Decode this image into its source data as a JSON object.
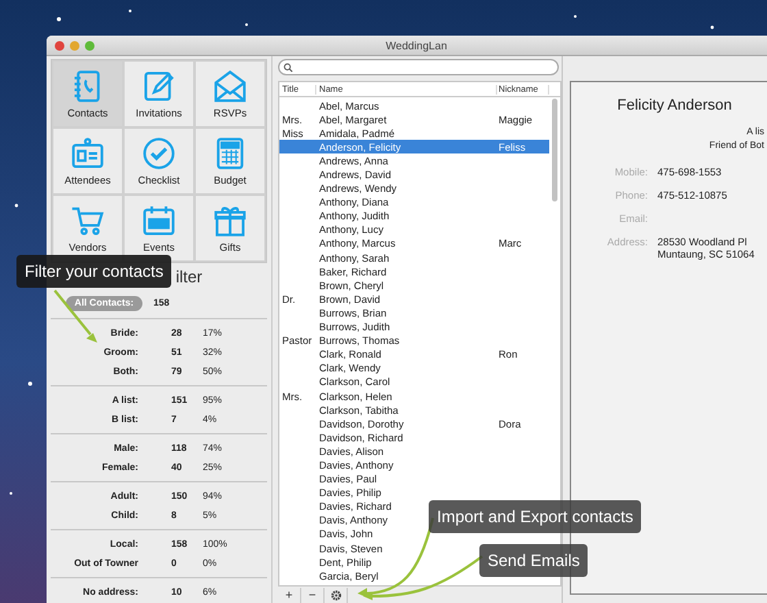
{
  "window": {
    "title": "WeddingLan"
  },
  "sections": [
    {
      "label": "Contacts",
      "selected": true
    },
    {
      "label": "Invitations",
      "selected": false
    },
    {
      "label": "RSVPs",
      "selected": false
    },
    {
      "label": "Attendees",
      "selected": false
    },
    {
      "label": "Checklist",
      "selected": false
    },
    {
      "label": "Budget",
      "selected": false
    },
    {
      "label": "Vendors",
      "selected": false
    },
    {
      "label": "Events",
      "selected": false
    },
    {
      "label": "Gifts",
      "selected": false
    }
  ],
  "filter": {
    "heading": "ilter",
    "all": {
      "label": "All Contacts:",
      "count": "158"
    },
    "groups": [
      [
        {
          "label": "Bride:",
          "count": "28",
          "percent": "17%"
        },
        {
          "label": "Groom:",
          "count": "51",
          "percent": "32%"
        },
        {
          "label": "Both:",
          "count": "79",
          "percent": "50%"
        }
      ],
      [
        {
          "label": "A list:",
          "count": "151",
          "percent": "95%"
        },
        {
          "label": "B list:",
          "count": "7",
          "percent": "4%"
        }
      ],
      [
        {
          "label": "Male:",
          "count": "118",
          "percent": "74%"
        },
        {
          "label": "Female:",
          "count": "40",
          "percent": "25%"
        }
      ],
      [
        {
          "label": "Adult:",
          "count": "150",
          "percent": "94%"
        },
        {
          "label": "Child:",
          "count": "8",
          "percent": "5%"
        }
      ],
      [
        {
          "label": "Local:",
          "count": "158",
          "percent": "100%"
        },
        {
          "label": "Out of Towner",
          "count": "0",
          "percent": "0%"
        }
      ],
      [
        {
          "label": "No address:",
          "count": "10",
          "percent": "6%"
        }
      ]
    ]
  },
  "table": {
    "columns": [
      "Title",
      "Name",
      "Nickname"
    ],
    "rows": [
      {
        "title": "",
        "name": "Abel, Marcus",
        "nickname": "",
        "selected": false
      },
      {
        "title": "Mrs.",
        "name": "Abel, Margaret",
        "nickname": "Maggie",
        "selected": false
      },
      {
        "title": "Miss",
        "name": "Amidala, Padmé",
        "nickname": "",
        "selected": false
      },
      {
        "title": "",
        "name": "Anderson, Felicity",
        "nickname": "Feliss",
        "selected": true
      },
      {
        "title": "",
        "name": "Andrews, Anna",
        "nickname": "",
        "selected": false
      },
      {
        "title": "",
        "name": "Andrews, David",
        "nickname": "",
        "selected": false
      },
      {
        "title": "",
        "name": "Andrews, Wendy",
        "nickname": "",
        "selected": false
      },
      {
        "title": "",
        "name": "Anthony, Diana",
        "nickname": "",
        "selected": false
      },
      {
        "title": "",
        "name": "Anthony, Judith",
        "nickname": "",
        "selected": false
      },
      {
        "title": "",
        "name": "Anthony, Lucy",
        "nickname": "",
        "selected": false
      },
      {
        "title": "",
        "name": "Anthony, Marcus",
        "nickname": "Marc",
        "selected": false
      },
      {
        "title": "",
        "name": "Anthony, Sarah",
        "nickname": "",
        "selected": false
      },
      {
        "title": "",
        "name": "Baker, Richard",
        "nickname": "",
        "selected": false
      },
      {
        "title": "",
        "name": "Brown, Cheryl",
        "nickname": "",
        "selected": false
      },
      {
        "title": "Dr.",
        "name": "Brown, David",
        "nickname": "",
        "selected": false
      },
      {
        "title": "",
        "name": "Burrows, Brian",
        "nickname": "",
        "selected": false
      },
      {
        "title": "",
        "name": "Burrows, Judith",
        "nickname": "",
        "selected": false
      },
      {
        "title": "Pastor",
        "name": "Burrows, Thomas",
        "nickname": "",
        "selected": false
      },
      {
        "title": "",
        "name": "Clark, Ronald",
        "nickname": "Ron",
        "selected": false
      },
      {
        "title": "",
        "name": "Clark, Wendy",
        "nickname": "",
        "selected": false
      },
      {
        "title": "",
        "name": "Clarkson, Carol",
        "nickname": "",
        "selected": false
      },
      {
        "title": "Mrs.",
        "name": "Clarkson, Helen",
        "nickname": "",
        "selected": false
      },
      {
        "title": "",
        "name": "Clarkson, Tabitha",
        "nickname": "",
        "selected": false
      },
      {
        "title": "",
        "name": "Davidson, Dorothy",
        "nickname": "Dora",
        "selected": false
      },
      {
        "title": "",
        "name": "Davidson, Richard",
        "nickname": "",
        "selected": false
      },
      {
        "title": "",
        "name": "Davies, Alison",
        "nickname": "",
        "selected": false
      },
      {
        "title": "",
        "name": "Davies, Anthony",
        "nickname": "",
        "selected": false
      },
      {
        "title": "",
        "name": "Davies, Paul",
        "nickname": "",
        "selected": false
      },
      {
        "title": "",
        "name": "Davies, Philip",
        "nickname": "",
        "selected": false
      },
      {
        "title": "",
        "name": "Davies, Richard",
        "nickname": "",
        "selected": false
      },
      {
        "title": "",
        "name": "Davis, Anthony",
        "nickname": "",
        "selected": false
      },
      {
        "title": "",
        "name": "Davis, John",
        "nickname": "",
        "selected": false
      },
      {
        "title": "",
        "name": "Davis, Steven",
        "nickname": "",
        "selected": false
      },
      {
        "title": "",
        "name": "Dent, Philip",
        "nickname": "",
        "selected": false
      },
      {
        "title": "",
        "name": "Garcia, Beryl",
        "nickname": "",
        "selected": false
      }
    ]
  },
  "toolbar": [
    "+",
    "−"
  ],
  "detail": {
    "name": "Felicity Anderson",
    "list": "A lis",
    "relation": "Friend of Bot",
    "fields": [
      {
        "label": "Mobile:",
        "lines": [
          "475-698-1553"
        ]
      },
      {
        "label": "Phone:",
        "lines": [
          "475-512-10875"
        ]
      },
      {
        "label": "Email:"
      },
      {
        "label": "Address:",
        "lines": [
          "28530 Woodland Pl",
          "Muntaung, SC 51064"
        ]
      }
    ]
  },
  "tooltips": [
    "Filter your contacts",
    "Import and Export contacts",
    "Send Emails"
  ]
}
